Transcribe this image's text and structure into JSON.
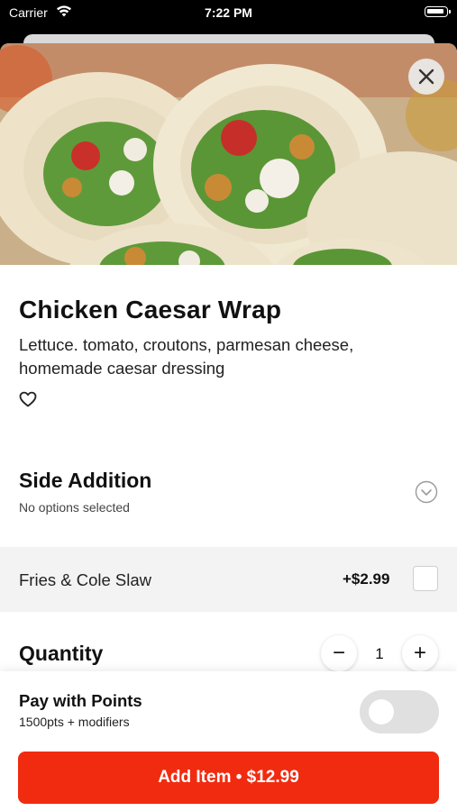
{
  "status_bar": {
    "carrier": "Carrier",
    "time": "7:22 PM"
  },
  "item": {
    "title": "Chicken Caesar Wrap",
    "description": "Lettuce. tomato, croutons, parmesan cheese, homemade caesar dressing",
    "image_icon": "wrap-photo",
    "favorited": false
  },
  "side_addition": {
    "title": "Side Addition",
    "subtitle": "No options selected",
    "options": [
      {
        "label": "Fries & Cole Slaw",
        "price": "+$2.99",
        "checked": false
      }
    ]
  },
  "quantity": {
    "title": "Quantity",
    "value": "1",
    "decrement": "−",
    "increment": "+"
  },
  "points": {
    "title": "Pay with Points",
    "subtitle": "1500pts + modifiers",
    "enabled": false
  },
  "cta": {
    "label": "Add Item • $12.99"
  },
  "colors": {
    "accent": "#f12b10",
    "toggle_off": "#e0e0e0",
    "option_bg": "#f3f3f3"
  }
}
